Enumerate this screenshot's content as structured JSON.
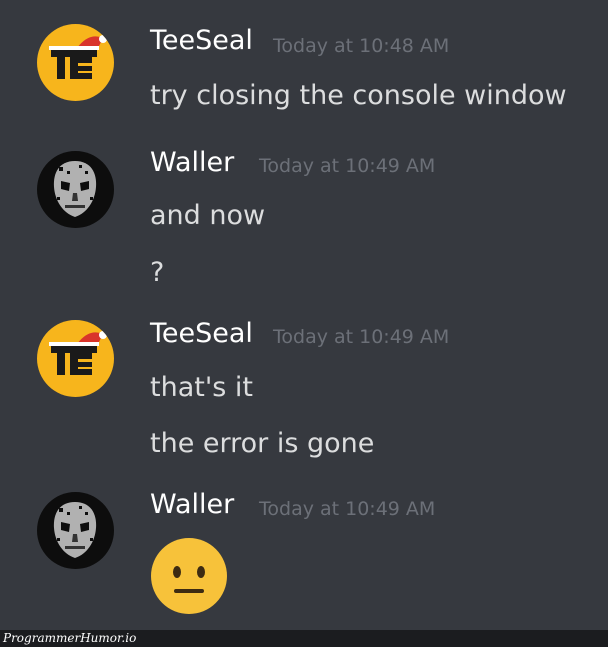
{
  "messages": [
    {
      "author": "TeeSeal",
      "timestamp": "Today at 10:48 AM",
      "avatar_icon": "teeseal-avatar-icon",
      "lines": [
        "try closing the console window"
      ]
    },
    {
      "author": "Waller",
      "timestamp": "Today at 10:49 AM",
      "avatar_icon": "skull-mask-avatar-icon",
      "lines": [
        "and now",
        "?"
      ]
    },
    {
      "author": "TeeSeal",
      "timestamp": "Today at 10:49 AM",
      "avatar_icon": "teeseal-avatar-icon",
      "lines": [
        "that's it",
        "the error is gone"
      ]
    },
    {
      "author": "Waller",
      "timestamp": "Today at 10:49 AM",
      "avatar_icon": "skull-mask-avatar-icon",
      "emoji": "neutral-face-emoji"
    }
  ],
  "watermark": "ProgrammerHumor.io",
  "colors": {
    "background": "#36393f",
    "author": "#ffffff",
    "timestamp": "#6c7078",
    "text": "#dcddde",
    "teeseal_avatar": "#f7b51c",
    "emoji": "#f7c23a"
  }
}
